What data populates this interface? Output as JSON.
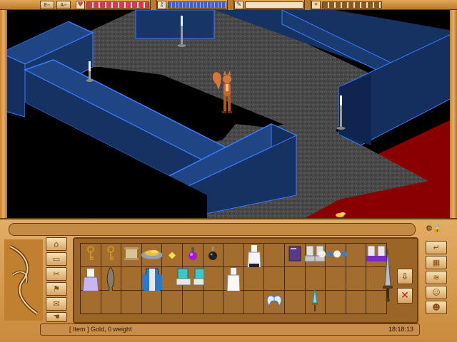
{
  "topbar": {
    "btn1": "E∽",
    "btn2": "A∽",
    "hearts_icon": "heart-icon",
    "hearts_level": 1.0,
    "mana_icon": "mana-wand-icon",
    "mana_level": 1.0,
    "xp_icon": "feather-icon",
    "xp_level": 0.0,
    "stars_icon": "star-arrow-icon",
    "stars_level": 1.0
  },
  "colors": {
    "wall_blue": "#1d3f7a",
    "wall_edge": "#3a7cff",
    "floor_gray": "#4a4a4a",
    "carpet_red": "#8a0000"
  },
  "left_buttons": [
    "home-icon",
    "folder-icon",
    "tools-icon",
    "backpack-icon",
    "chat-icon",
    "hand-icon"
  ],
  "right_buttons": [
    "enter-icon",
    "map-icon",
    "scroll-icon",
    "people-icon",
    "party-icon"
  ],
  "inventory": {
    "row1": [
      "brass-key",
      "brass-key",
      "parchment-scroll",
      "gold-pile",
      "yellow-gem",
      "purple-potion",
      "black-bomb",
      "",
      "white-dress",
      "",
      "purple-book",
      "white-boots",
      "white-beads",
      "",
      "white-purple-boots"
    ],
    "row2": [
      "lavender-dress",
      "wooden-mask",
      "",
      "blue-robe",
      "",
      "cyan-boots",
      "",
      "white-gown",
      "",
      "",
      "",
      "",
      "",
      "",
      ""
    ],
    "row3": [
      "",
      "",
      "",
      "",
      "",
      "",
      "",
      "",
      "",
      "angel-wings",
      "",
      "cyan-dagger",
      "",
      "",
      ""
    ],
    "sword": "steel-sword"
  },
  "status": {
    "text": "[ Item ] Gold, 0 weight",
    "time": "18:18:13"
  }
}
